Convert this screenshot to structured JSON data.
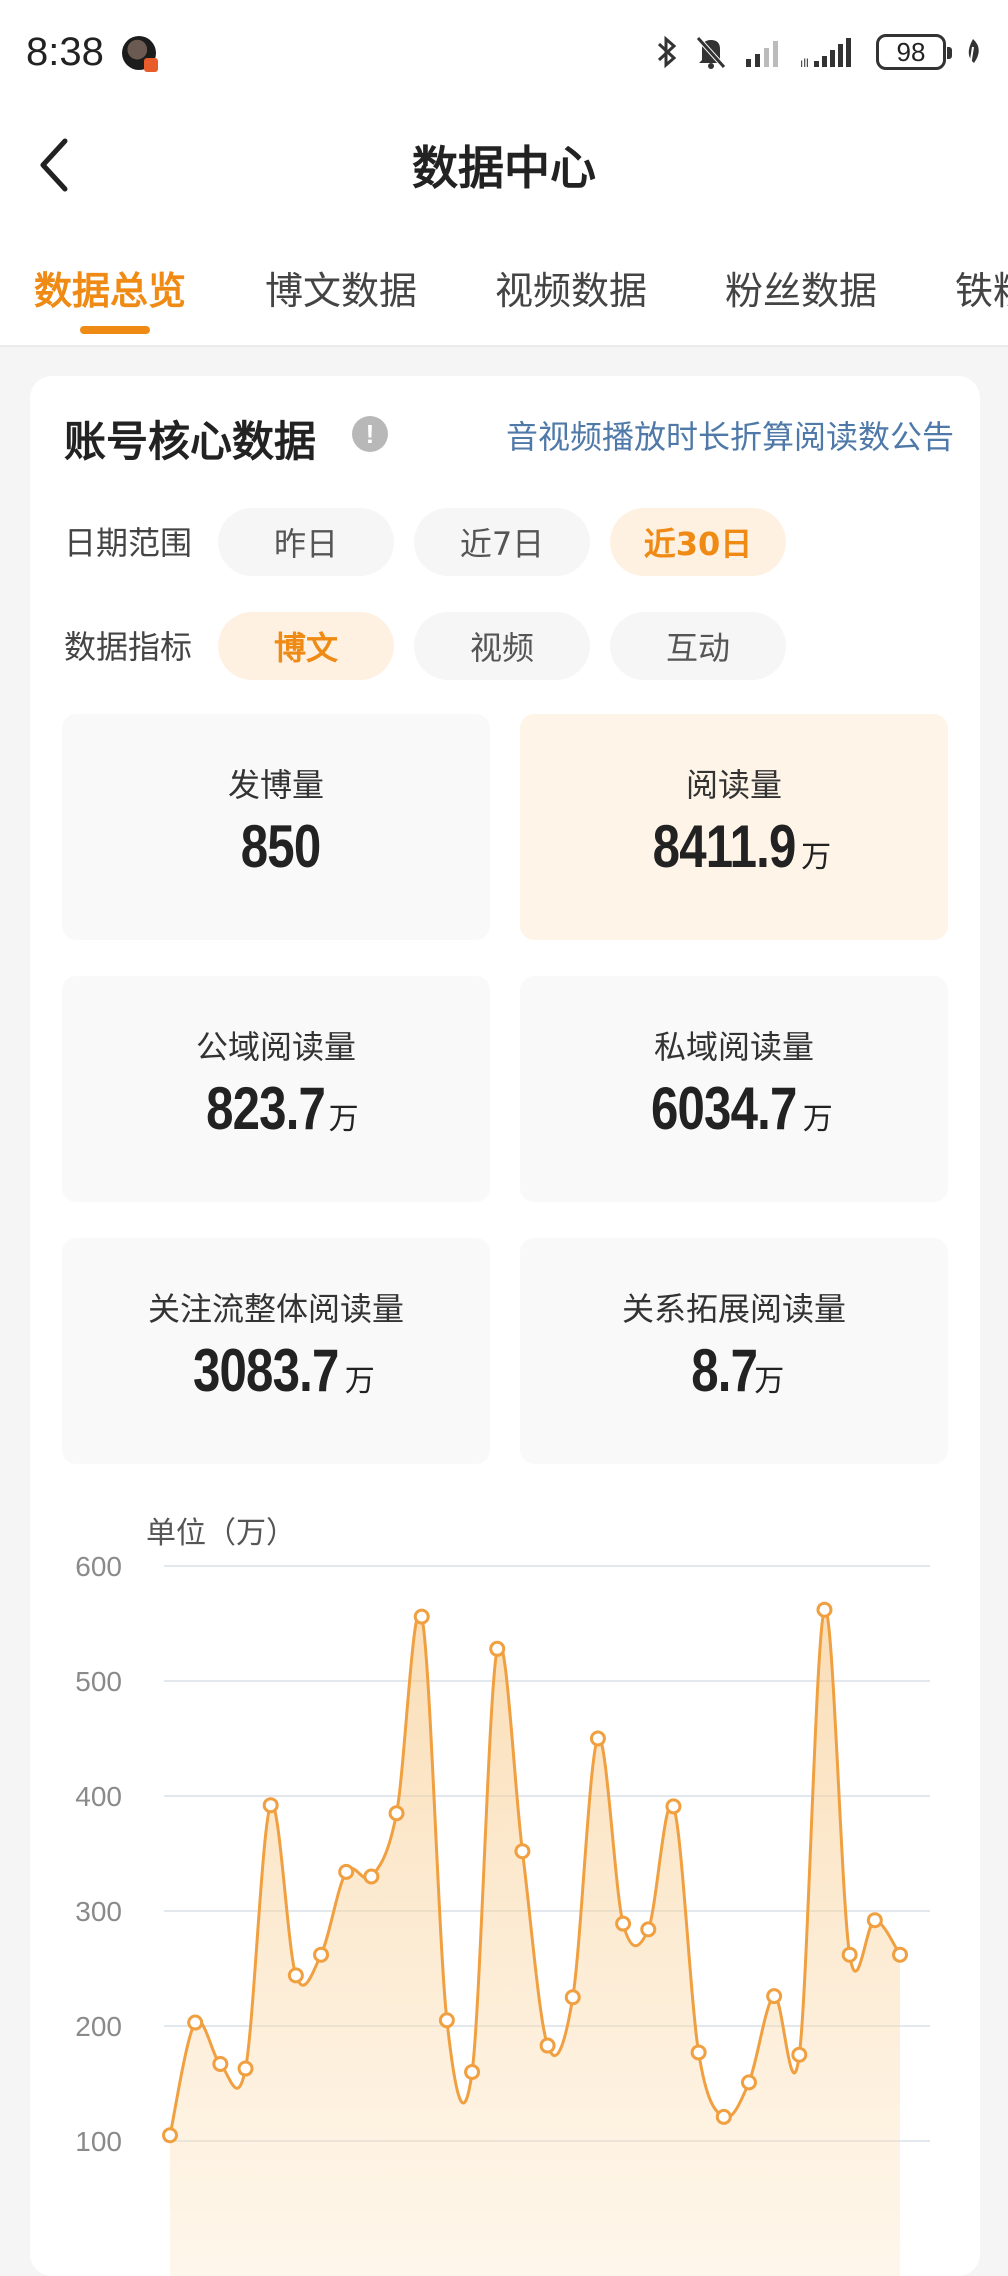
{
  "status_bar": {
    "time": "8:38",
    "battery": "98",
    "icons": [
      "bluetooth-icon",
      "mute-bell-icon",
      "signal-weak-icon",
      "signal-strong-icon",
      "battery-icon",
      "leaf-icon"
    ]
  },
  "header": {
    "title": "数据中心",
    "back_icon": "chevron-left-icon"
  },
  "tabs": [
    {
      "label": "数据总览",
      "active": true
    },
    {
      "label": "博文数据",
      "active": false
    },
    {
      "label": "视频数据",
      "active": false
    },
    {
      "label": "粉丝数据",
      "active": false
    },
    {
      "label": "铁粉",
      "active": false
    }
  ],
  "card": {
    "title": "账号核心数据",
    "info_icon": "info-icon",
    "notice_link": "音视频播放时长折算阅读数公告",
    "date_range": {
      "label": "日期范围",
      "options": [
        "昨日",
        "近7日",
        "近30日"
      ],
      "selected": "近30日"
    },
    "metric_type": {
      "label": "数据指标",
      "options": [
        "博文",
        "视频",
        "互动"
      ],
      "selected": "博文"
    },
    "metrics": [
      {
        "label": "发博量",
        "value": "850",
        "unit": ""
      },
      {
        "label": "阅读量",
        "value": "8411.9",
        "unit": "万"
      },
      {
        "label": "公域阅读量",
        "value": "823.7",
        "unit": "万"
      },
      {
        "label": "私域阅读量",
        "value": "6034.7",
        "unit": "万"
      },
      {
        "label": "关注流整体阅读量",
        "value": "3083.7",
        "unit": "万"
      },
      {
        "label": "关系拓展阅读量",
        "value": "8.7",
        "unit": "万"
      }
    ],
    "chart_unit": "单位（万）"
  },
  "chart_data": {
    "type": "area",
    "title": "",
    "ylabel": "单位（万）",
    "xlabel": "",
    "ylim": [
      100,
      600
    ],
    "yticks": [
      100,
      200,
      300,
      400,
      500,
      600
    ],
    "grid": true,
    "color": "#f0a040",
    "series": [
      {
        "values": [
          105,
          203,
          167,
          163,
          392,
          244,
          262,
          334,
          330,
          385,
          556,
          205,
          160,
          528,
          352,
          183,
          225,
          450,
          289,
          284,
          391,
          177,
          121,
          151,
          226,
          175,
          562,
          262,
          292,
          262
        ]
      }
    ]
  }
}
